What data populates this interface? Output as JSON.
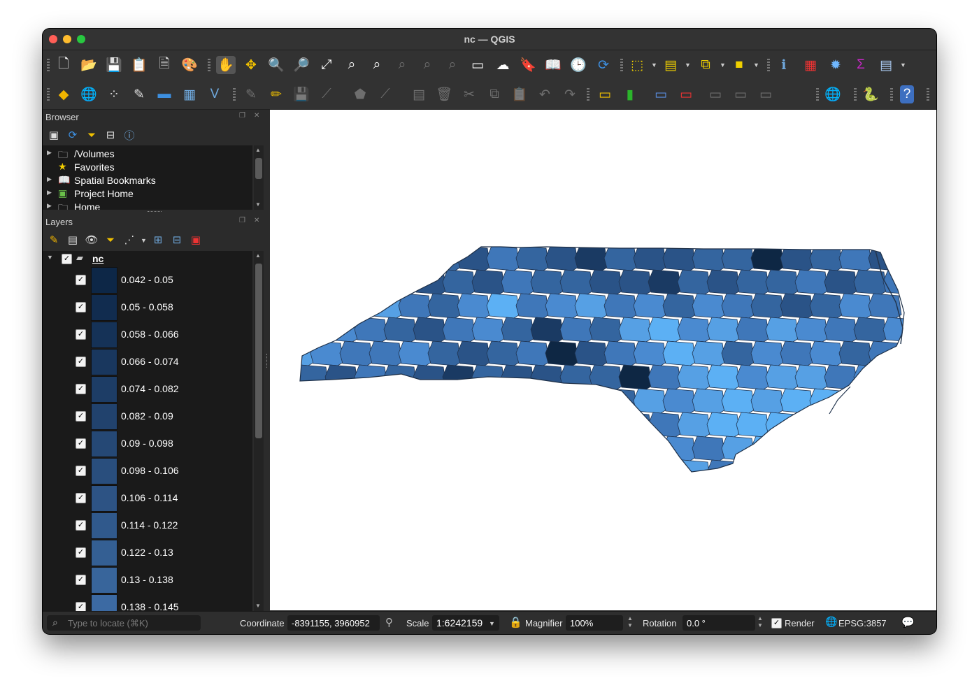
{
  "window": {
    "title": "nc — QGIS"
  },
  "browser": {
    "title": "Browser",
    "items": [
      {
        "label": "/Volumes",
        "icon": "folder-icon"
      },
      {
        "label": "Favorites",
        "icon": "star-icon"
      },
      {
        "label": "Spatial Bookmarks",
        "icon": "bookmark-icon"
      },
      {
        "label": "Project Home",
        "icon": "project-home-icon"
      },
      {
        "label": "Home",
        "icon": "home-folder-icon"
      }
    ]
  },
  "layers": {
    "title": "Layers",
    "layer_name": "nc",
    "classes": [
      {
        "label": "0.042 - 0.05",
        "color": "#0d2747"
      },
      {
        "label": "0.05 - 0.058",
        "color": "#112c4f"
      },
      {
        "label": "0.058 - 0.066",
        "color": "#153257"
      },
      {
        "label": "0.066 - 0.074",
        "color": "#19375e"
      },
      {
        "label": "0.074 - 0.082",
        "color": "#1d3d66"
      },
      {
        "label": "0.082 - 0.09",
        "color": "#21426d"
      },
      {
        "label": "0.09 - 0.098",
        "color": "#254875"
      },
      {
        "label": "0.098 - 0.106",
        "color": "#294e7d"
      },
      {
        "label": "0.106 - 0.114",
        "color": "#2d5384"
      },
      {
        "label": "0.114 - 0.122",
        "color": "#30598c"
      },
      {
        "label": "0.122 - 0.13",
        "color": "#345f93"
      },
      {
        "label": "0.13 - 0.138",
        "color": "#38659b"
      },
      {
        "label": "0.138 - 0.145",
        "color": "#3c6aa3"
      }
    ]
  },
  "map": {
    "palette": [
      "#0e2744",
      "#1a3a63",
      "#2a5387",
      "#34659f",
      "#3f77b9",
      "#4a8ad0",
      "#56a0e4",
      "#5cb0f4"
    ],
    "county_color_indices": [
      3,
      2,
      3,
      1,
      2,
      3,
      2,
      4,
      3,
      2,
      1,
      3,
      2,
      2,
      3,
      3,
      0,
      2,
      3,
      4,
      2,
      3,
      3,
      1,
      2,
      2,
      3,
      2,
      4,
      3,
      3,
      2,
      2,
      1,
      3,
      2,
      3,
      3,
      4,
      2,
      3,
      4,
      3,
      4,
      5,
      6,
      4,
      3,
      5,
      7,
      4,
      5,
      6,
      4,
      5,
      3,
      5,
      4,
      3,
      2,
      3,
      5,
      4,
      6,
      5,
      4,
      3,
      2,
      4,
      5,
      3,
      1,
      4,
      3,
      6,
      5,
      3,
      4,
      2,
      4,
      3,
      2,
      1,
      3,
      6,
      5,
      4,
      4,
      5,
      3,
      2,
      3,
      4,
      0,
      2,
      4,
      3,
      5,
      4,
      1
    ],
    "halfheight": [
      0,
      1,
      0,
      0,
      1,
      0,
      0,
      0,
      0,
      0,
      0,
      1,
      1,
      0,
      0,
      0,
      0,
      0,
      0,
      0,
      0,
      0,
      0,
      0,
      0,
      0,
      0,
      0,
      0,
      0,
      0,
      0,
      0,
      0,
      0,
      0,
      0,
      0,
      0,
      0,
      0,
      0,
      0,
      0,
      0,
      0,
      0,
      0,
      0,
      0,
      0,
      0,
      0,
      0,
      0,
      0,
      0,
      0,
      0,
      0,
      0,
      0,
      0,
      0,
      0,
      0,
      0,
      0,
      0,
      0,
      0,
      0,
      0,
      0,
      0,
      0,
      0,
      0,
      0,
      0,
      0,
      0,
      0,
      0,
      0,
      0,
      0,
      0,
      0,
      0,
      0,
      0,
      0,
      0,
      0,
      0,
      0,
      0,
      0,
      0
    ]
  },
  "status": {
    "locate_placeholder": "Type to locate (⌘K)",
    "coordinate_label": "Coordinate",
    "coordinate_value": "-8391155, 3960952",
    "scale_label": "Scale",
    "scale_value": "1:6242159",
    "magnifier_label": "Magnifier",
    "magnifier_value": "100%",
    "rotation_label": "Rotation",
    "rotation_value": "0.0 °",
    "render_label": "Render",
    "crs_value": "EPSG:3857"
  }
}
